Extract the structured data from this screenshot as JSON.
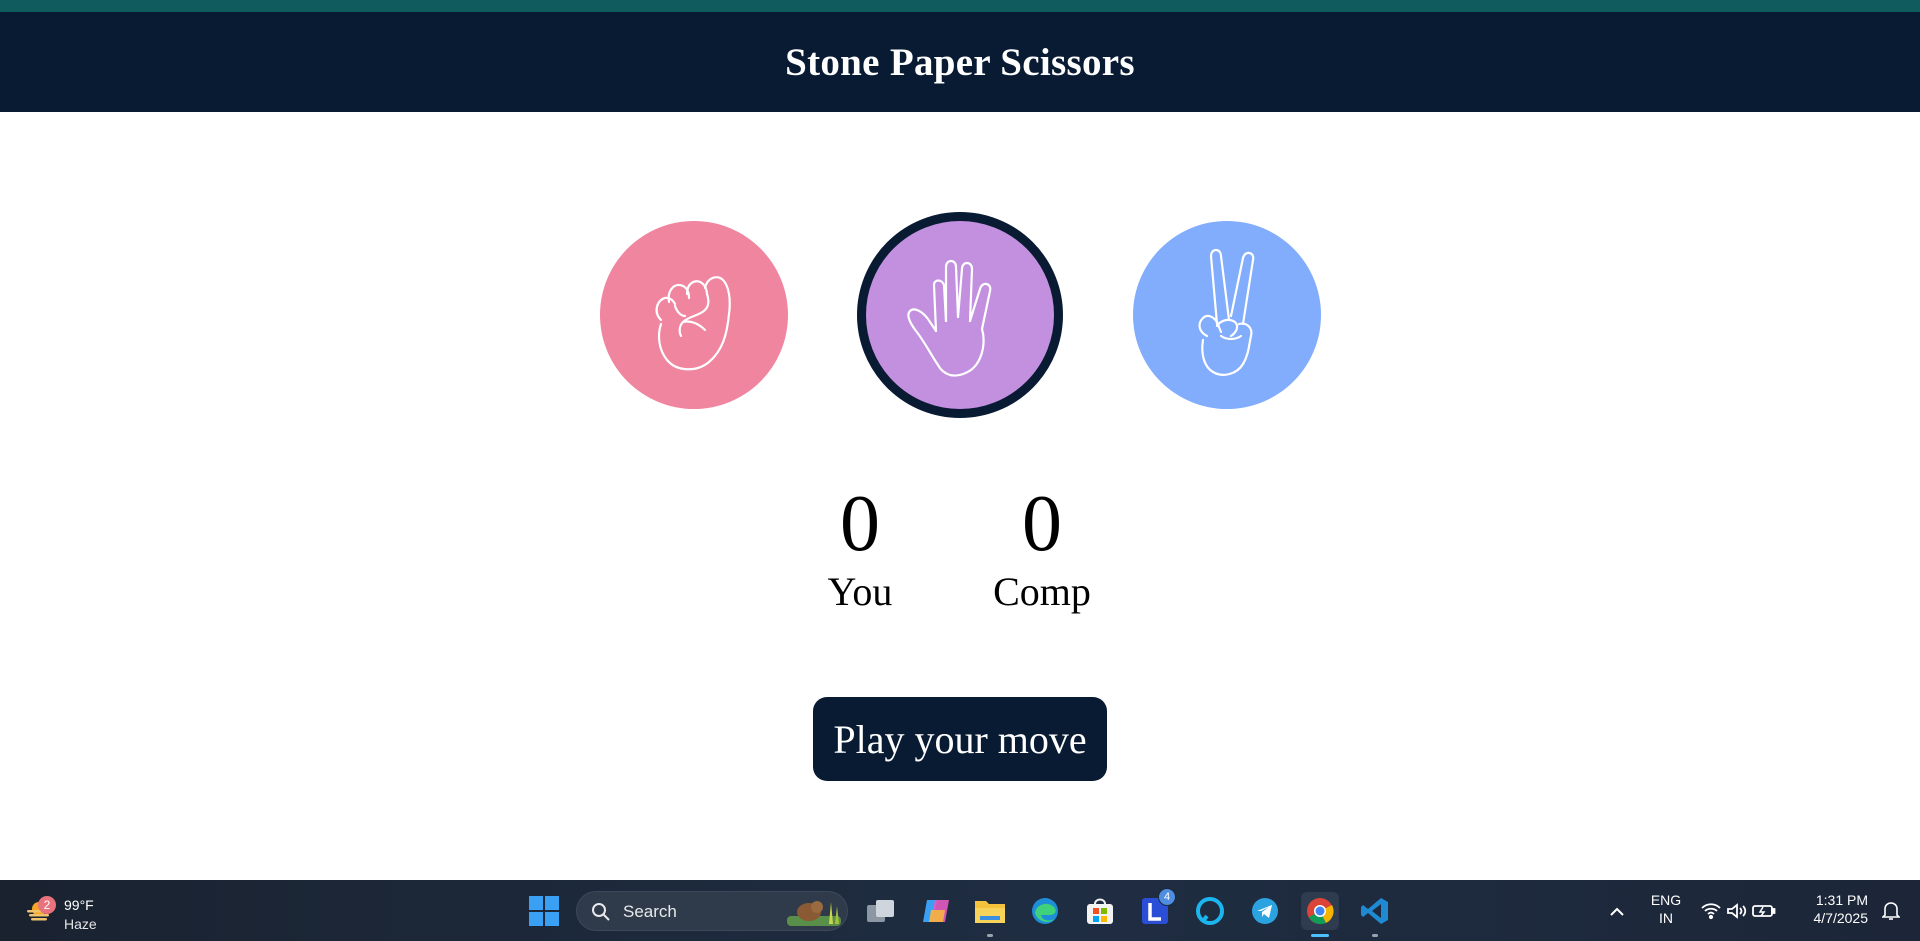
{
  "header": {
    "title": "Stone Paper Scissors"
  },
  "choices": {
    "stone": {
      "icon": "fist-icon",
      "color": "#f0859f"
    },
    "paper": {
      "icon": "open-hand-icon",
      "color": "#c290df",
      "selected": true
    },
    "scissors": {
      "icon": "victory-hand-icon",
      "color": "#82acfc"
    }
  },
  "scoreboard": {
    "user": {
      "score": "0",
      "label": "You"
    },
    "computer": {
      "score": "0",
      "label": "Comp"
    }
  },
  "message": {
    "text": "Play your move",
    "background": "#081b33"
  },
  "taskbar": {
    "weather": {
      "badge": "2",
      "temperature": "99°F",
      "condition": "Haze"
    },
    "search": {
      "placeholder": "Search"
    },
    "apps": [
      {
        "name": "start-icon"
      },
      {
        "name": "task-view-icon"
      },
      {
        "name": "copilot-icon"
      },
      {
        "name": "file-explorer-icon"
      },
      {
        "name": "edge-icon"
      },
      {
        "name": "store-icon"
      },
      {
        "name": "l-app-icon",
        "badge": "4"
      },
      {
        "name": "alexa-icon"
      },
      {
        "name": "telegram-icon"
      },
      {
        "name": "chrome-icon",
        "active": true
      },
      {
        "name": "vscode-icon"
      }
    ],
    "tray": {
      "language": "ENG",
      "region": "IN",
      "time": "1:31 PM",
      "date": "4/7/2025"
    }
  }
}
